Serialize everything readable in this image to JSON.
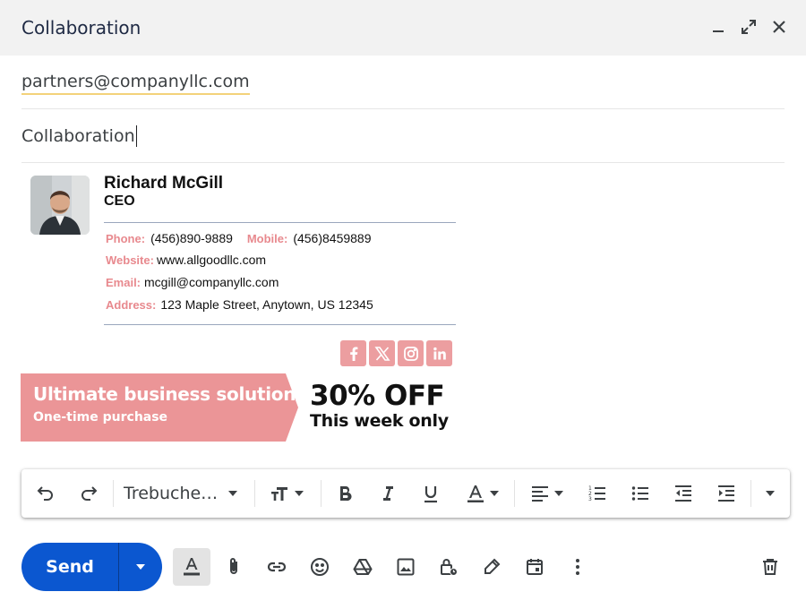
{
  "window": {
    "title": "Collaboration"
  },
  "compose": {
    "to": "partners@companyllc.com",
    "subject": "Collaboration"
  },
  "signature": {
    "name": "Richard McGill",
    "role": "CEO",
    "phone_label": "Phone:",
    "phone": "(456)890-9889",
    "mobile_label": "Mobile:",
    "mobile": "(456)8459889",
    "website_label": "Website:",
    "website": "www.allgoodllc.com",
    "email_label": "Email:",
    "email": "mcgill@companyllc.com",
    "address_label": "Address:",
    "address": "123 Maple Street, Anytown, US 12345",
    "socials": [
      "facebook-icon",
      "x-icon",
      "instagram-icon",
      "linkedin-icon"
    ],
    "banner": {
      "headline": "Ultimate business solution",
      "subline": "One-time purchase",
      "offer": "30% OFF",
      "offer_sub": "This week only"
    }
  },
  "toolbar": {
    "font": "Trebuche…",
    "buttons": [
      "undo-icon",
      "redo-icon",
      "text-size-icon",
      "bold-icon",
      "italic-icon",
      "underline-icon",
      "text-color-icon",
      "align-icon",
      "numbered-list-icon",
      "bulleted-list-icon",
      "indent-less-icon",
      "indent-more-icon",
      "more-formatting-icon"
    ]
  },
  "bottom": {
    "send_label": "Send",
    "actions": [
      "formatting-icon",
      "attach-icon",
      "link-icon",
      "emoji-icon",
      "drive-icon",
      "photo-icon",
      "confidential-icon",
      "signature-icon",
      "schedule-icon",
      "more-options-icon",
      "discard-icon"
    ]
  },
  "colors": {
    "accent": "#0b57d0",
    "signature_pink": "#ec9ea0",
    "label_pink": "#e8898e",
    "banner_pink": "#eb9597"
  }
}
